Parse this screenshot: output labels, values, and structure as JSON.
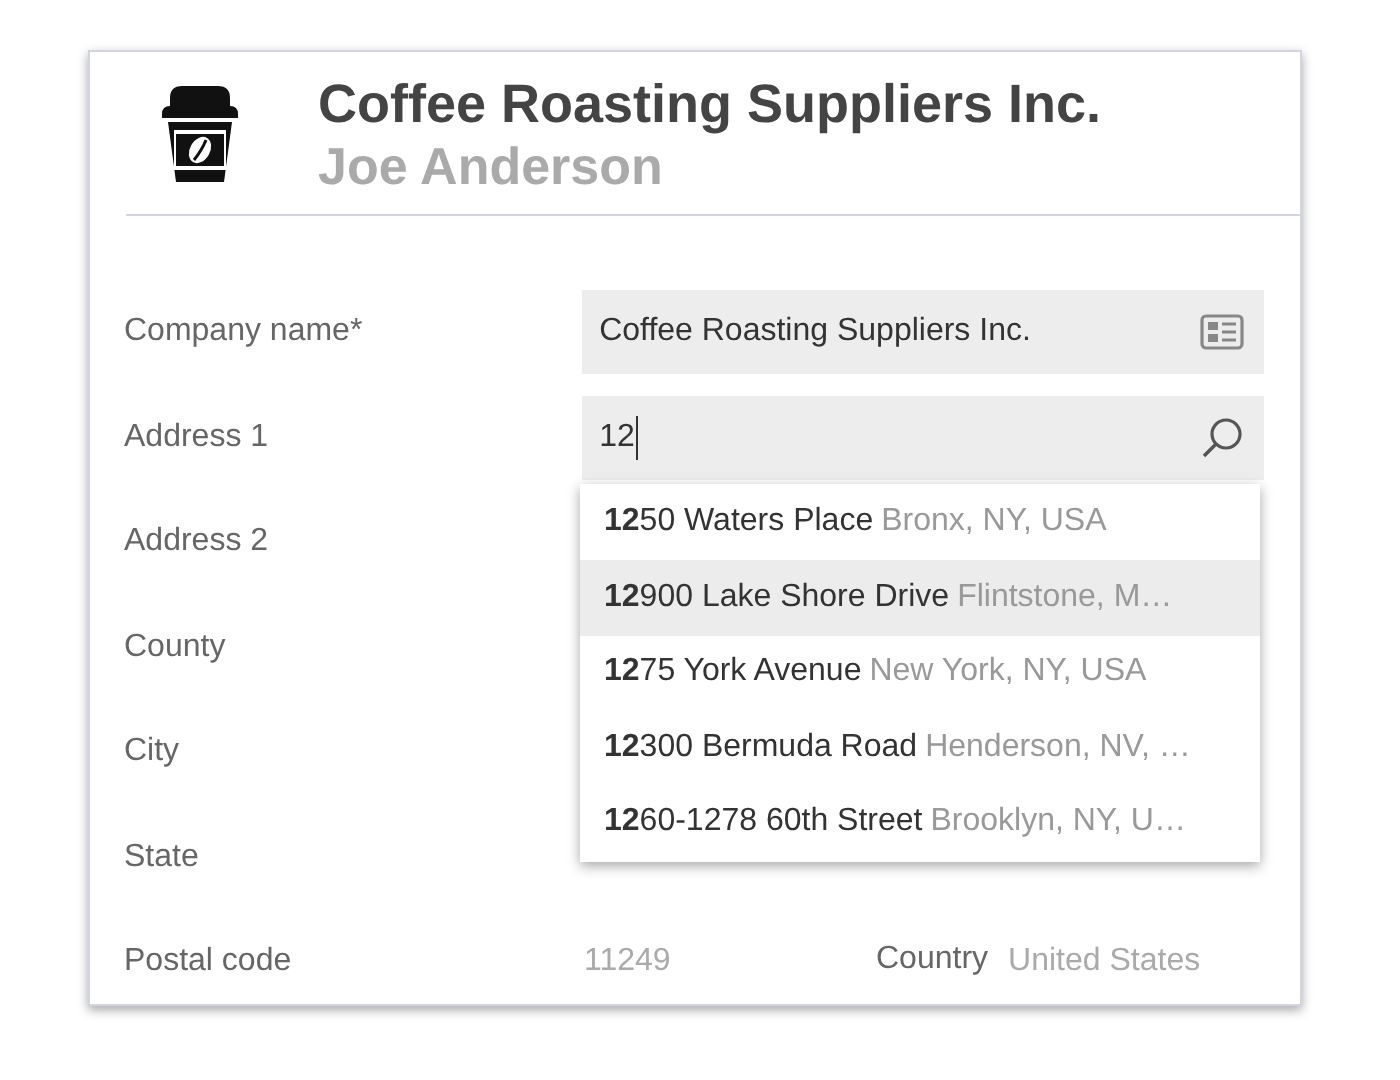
{
  "header": {
    "title": "Coffee Roasting Suppliers Inc.",
    "subtitle": "Joe Anderson"
  },
  "fields": [
    {
      "label": "Company name*",
      "kind": "lookup",
      "value": "Coffee Roasting Suppliers Inc.",
      "focused": false
    },
    {
      "label": "Address 1",
      "kind": "search",
      "value": "12",
      "focused": true
    },
    {
      "label": "Address 2",
      "kind": "text"
    },
    {
      "label": "County",
      "kind": "text"
    },
    {
      "label": "City",
      "kind": "text"
    },
    {
      "label": "State",
      "kind": "text"
    },
    {
      "label": "Postal code",
      "kind": "text",
      "value": "11249",
      "extra": {
        "label": "Country",
        "value": "United States"
      }
    }
  ],
  "suggestions": [
    {
      "street": "**12**50 Waters Place",
      "place": "Bronx, NY, USA",
      "selected": false
    },
    {
      "street": "**12**900 Lake Shore Drive",
      "place": "Flintstone, M…",
      "selected": true
    },
    {
      "street": "**12**75 York Avenue",
      "place": "New York, NY, USA",
      "selected": false
    },
    {
      "street": "**12**300 Bermuda Road",
      "place": "Henderson, NV, …",
      "selected": false
    },
    {
      "street": "**12**60-1278 60th Street",
      "place": "Brooklyn, NY, U…",
      "selected": false
    }
  ]
}
